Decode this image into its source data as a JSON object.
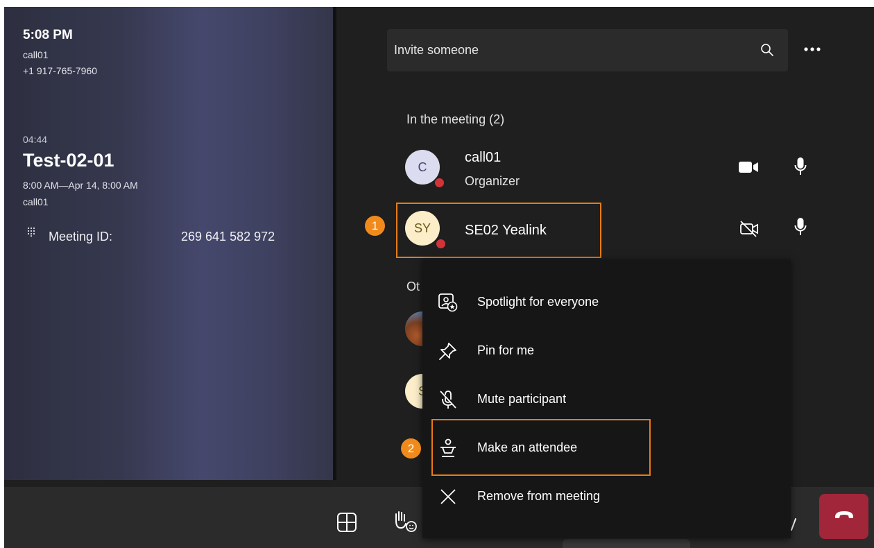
{
  "left_panel": {
    "time": "5:08 PM",
    "call_name": "call01",
    "phone_number": "+1 917-765-7960",
    "elapsed": "04:44",
    "meeting_title": "Test-02-01",
    "meeting_time": "8:00 AM—Apr 14, 8:00 AM",
    "organizer": "call01",
    "meeting_id_label": "Meeting ID:",
    "meeting_id": "269 641 582 972"
  },
  "invite": {
    "placeholder": "Invite someone"
  },
  "in_meeting": {
    "header": "In the meeting (2)",
    "participants": [
      {
        "initials": "C",
        "name": "call01",
        "role": "Organizer",
        "video": "camera-on",
        "mic": "mic-on",
        "avatar_bg": "#dcdcf0",
        "avatar_fg": "#454574"
      },
      {
        "initials": "SY",
        "name": "SE02 Yealink",
        "role": "",
        "video": "camera-off",
        "mic": "mic-on",
        "avatar_bg": "#fbeec9",
        "avatar_fg": "#6b5a19"
      }
    ]
  },
  "others": {
    "header_visible": "Ot",
    "avatar_initial": "S"
  },
  "context_menu": {
    "items": [
      {
        "label": "Spotlight for everyone",
        "icon": "spotlight-icon"
      },
      {
        "label": "Pin for me",
        "icon": "pin-icon"
      },
      {
        "label": "Mute participant",
        "icon": "mic-off-icon"
      },
      {
        "label": "Make an attendee",
        "icon": "attendee-icon"
      },
      {
        "label": "Remove from meeting",
        "icon": "close-icon"
      }
    ]
  },
  "annotations": {
    "step1": "1",
    "step2": "2",
    "highlight_color": "#e97b16"
  },
  "colors": {
    "end_call": "#a1263a",
    "status_busy": "#d13438"
  }
}
